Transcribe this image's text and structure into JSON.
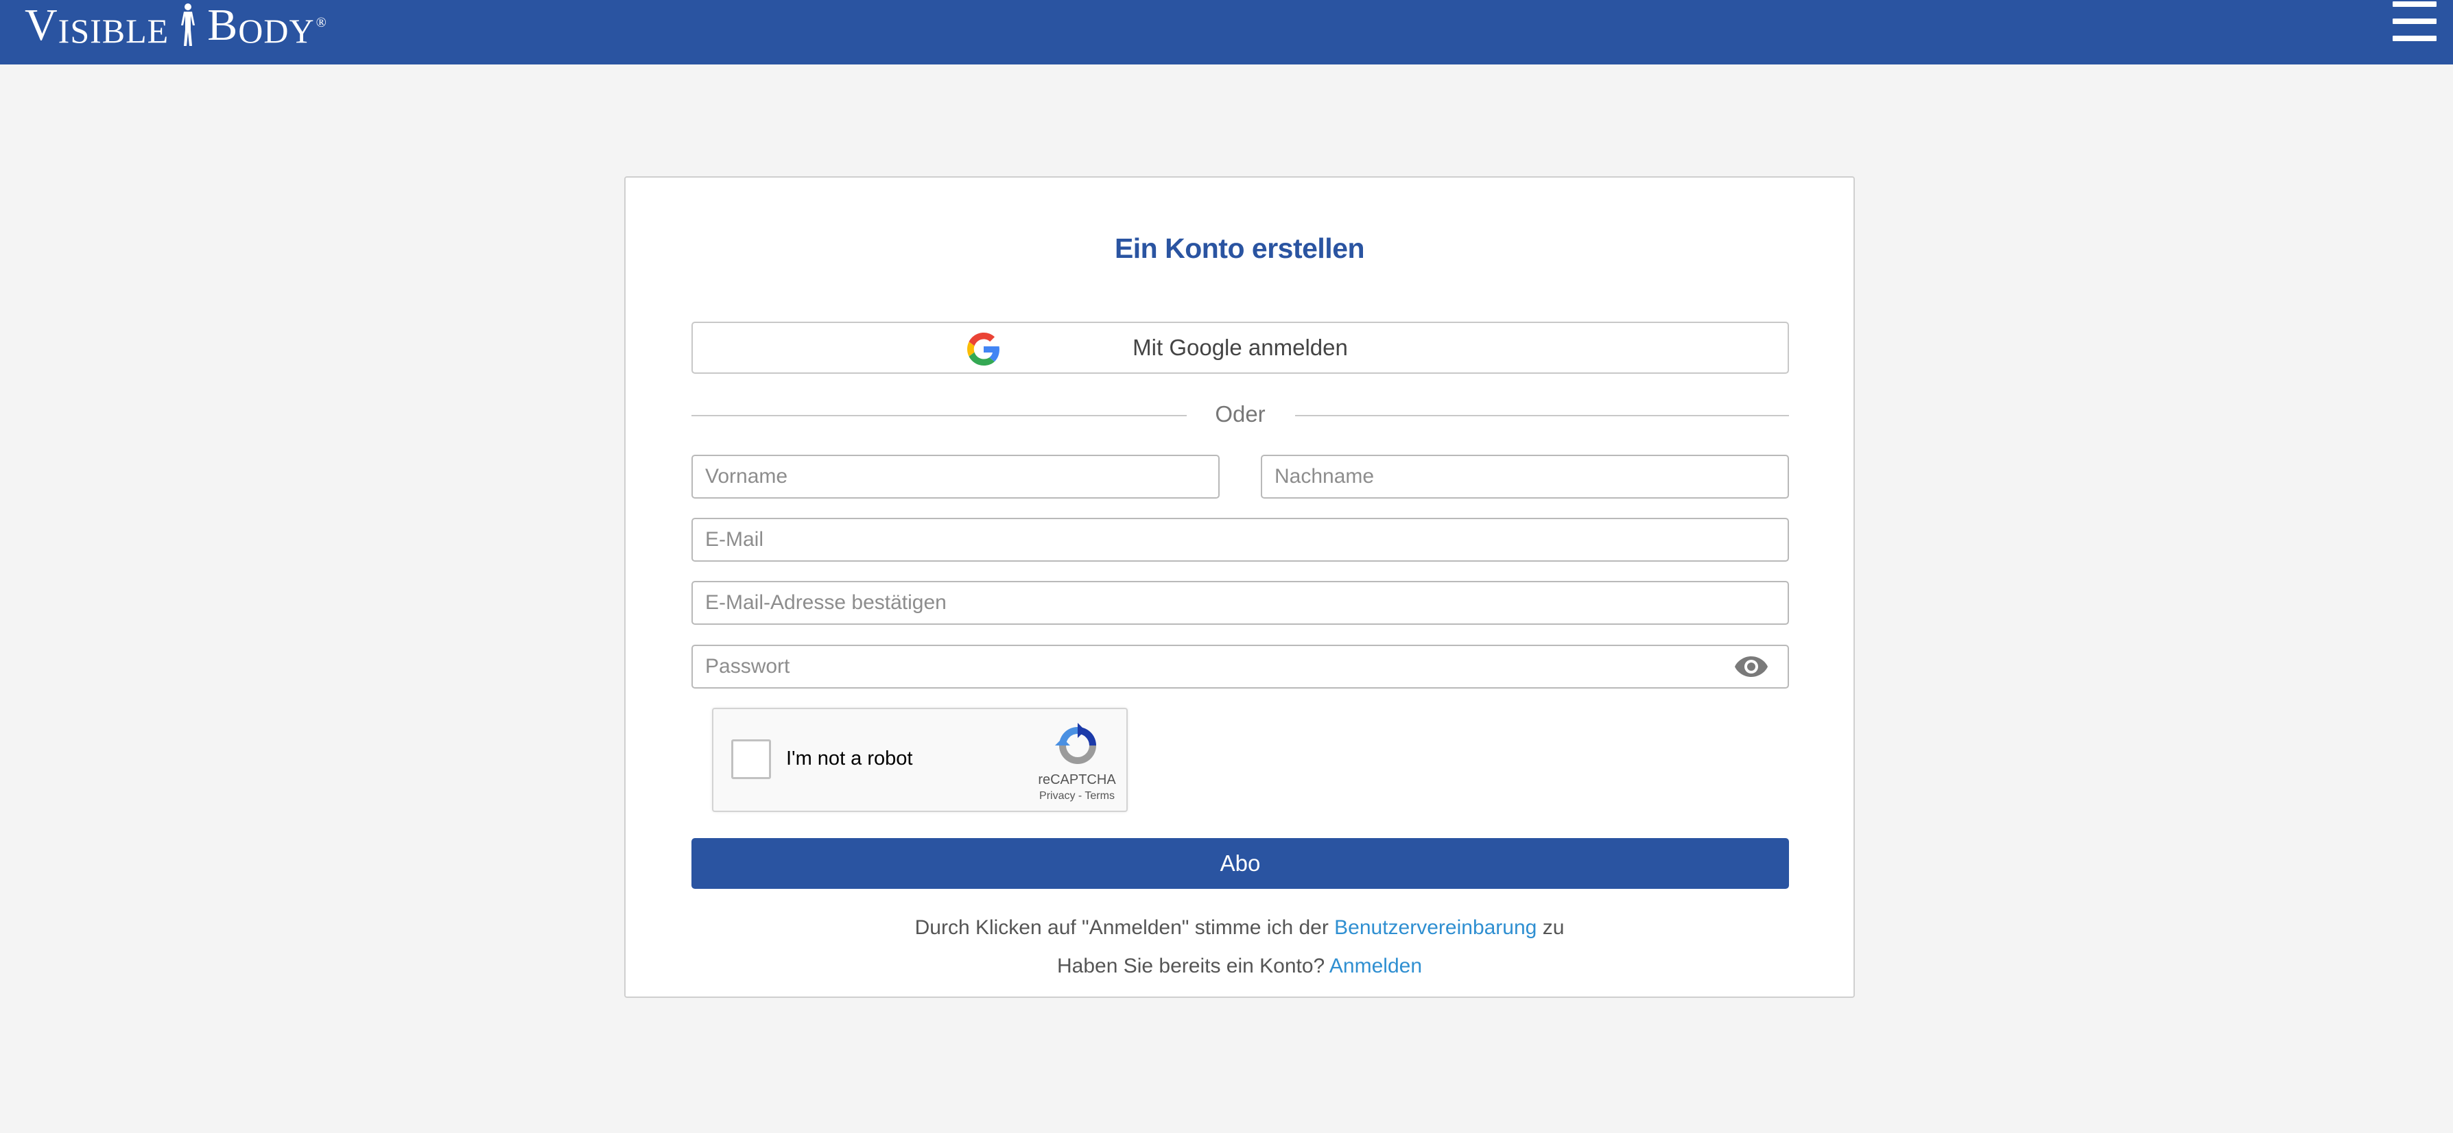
{
  "header": {
    "logo": {
      "word1_first": "V",
      "word1_rest": "ISIBLE",
      "word2_first": "B",
      "word2_rest": "ODY",
      "reg": "®"
    },
    "menu_icon": "hamburger-icon",
    "color": "#2a54a1"
  },
  "form": {
    "title": "Ein Konto erstellen",
    "google_button_label": "Mit Google anmelden",
    "google_icon": "google-g-icon",
    "divider_text": "Oder",
    "fields": {
      "first_name_placeholder": "Vorname",
      "last_name_placeholder": "Nachname",
      "email_placeholder": "E-Mail",
      "confirm_email_placeholder": "E-Mail-Adresse bestätigen",
      "password_placeholder": "Passwort"
    },
    "password_toggle_icon": "eye-icon",
    "recaptcha": {
      "label": "I'm not a robot",
      "brand": "reCAPTCHA",
      "privacy": "Privacy",
      "separator": " - ",
      "terms": "Terms",
      "icon": "recaptcha-icon"
    },
    "submit_label": "Abo",
    "terms_prefix": "Durch Klicken auf \"Anmelden\" stimme ich der ",
    "terms_link": "Benutzervereinbarung",
    "terms_suffix": " zu",
    "login_prefix": "Haben Sie bereits ein Konto? ",
    "login_link": "Anmelden"
  },
  "colors": {
    "brand": "#2a54a1",
    "link": "#2f8fd1",
    "background": "#f4f4f4"
  }
}
